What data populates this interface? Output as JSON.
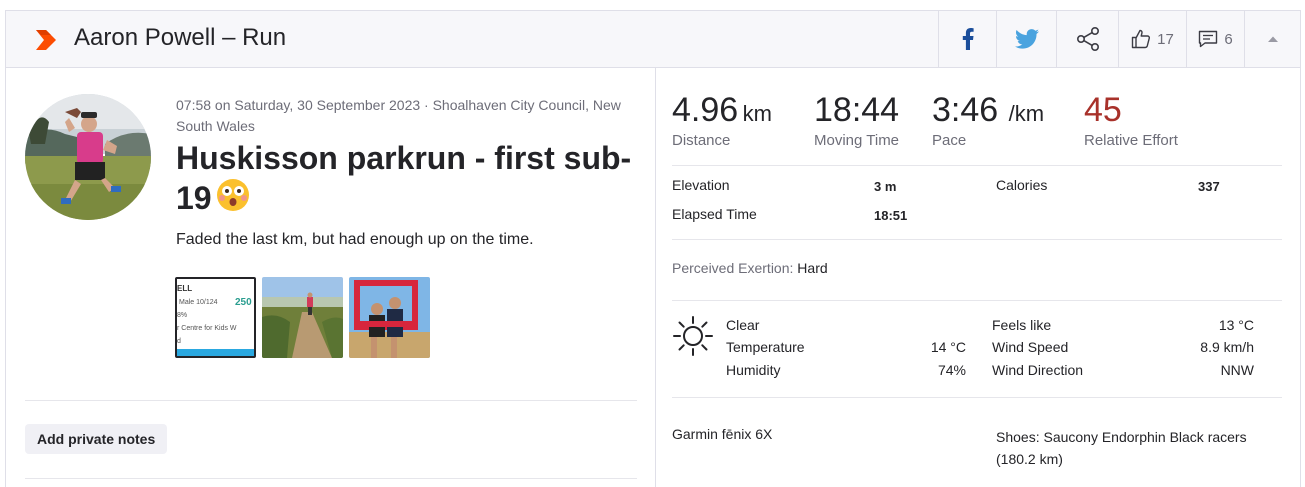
{
  "header": {
    "title": "Aaron Powell – Run",
    "kudos_count": "17",
    "comments_count": "6"
  },
  "activity": {
    "meta": "07:58 on Saturday, 30 September 2023 · Shoalhaven City Council, New South Wales",
    "name": "Huskisson parkrun - first sub-19",
    "description": "Faded the last km, but had enough up on the time.",
    "photo1_text": {
      "l1": "ELL",
      "l2": "Male 10/124",
      "l2b": "250",
      "l3": "8%",
      "l4": "r Centre for Kids W",
      "l5": "d"
    },
    "add_notes_label": "Add private notes"
  },
  "stats": {
    "distance": {
      "value": "4.96",
      "unit": "km",
      "label": "Distance"
    },
    "moving_time": {
      "value": "18:44",
      "label": "Moving Time"
    },
    "pace": {
      "value": "3:46",
      "unit": "/km",
      "label": "Pace"
    },
    "effort": {
      "value": "45",
      "label": "Relative Effort"
    },
    "elevation": {
      "label": "Elevation",
      "value": "3 m"
    },
    "calories": {
      "label": "Calories",
      "value": "337"
    },
    "elapsed": {
      "label": "Elapsed Time",
      "value": "18:51"
    },
    "perceived_label": "Perceived Exertion:",
    "perceived_value": "Hard"
  },
  "weather": {
    "condition": "Clear",
    "temperature_label": "Temperature",
    "temperature": "14 °C",
    "humidity_label": "Humidity",
    "humidity": "74%",
    "feels_label": "Feels like",
    "feels": "13 °C",
    "wind_speed_label": "Wind Speed",
    "wind_speed": "8.9 km/h",
    "wind_dir_label": "Wind Direction",
    "wind_dir": "NNW"
  },
  "gear": {
    "device": "Garmin fēnix 6X",
    "shoes_line1": "Shoes: Saucony Endorphin Black racers",
    "shoes_line2": "(180.2 km)"
  },
  "colors": {
    "brand": "#fc4c02",
    "effort": "#a8312a",
    "facebook": "#1b4e9b",
    "twitter": "#4aa3df"
  },
  "icons": [
    "run-sport-icon",
    "facebook-icon",
    "twitter-icon",
    "share-icon",
    "kudos-thumb-icon",
    "comment-icon",
    "collapse-caret-icon",
    "sun-icon",
    "shocked-face-emoji"
  ]
}
